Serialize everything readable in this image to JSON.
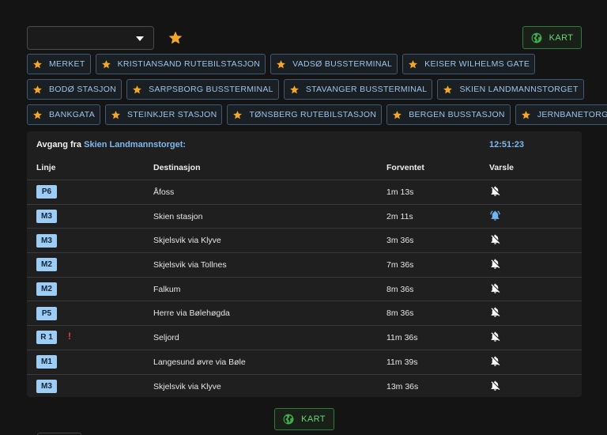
{
  "select": {
    "value": ""
  },
  "map_button": {
    "label": "KART"
  },
  "favorites": [
    [
      "MERKET",
      "KRISTIANSAND RUTEBILSTASJON",
      "VADSØ BUSSTERMINAL",
      "KEISER WILHELMS GATE"
    ],
    [
      "BODØ STASJON",
      "SARPSBORG BUSSTERMINAL",
      "STAVANGER BUSSTERMINAL",
      "SKIEN LANDMANNSTORGET"
    ],
    [
      "BANKGATA",
      "STEINKJER STASJON",
      "TØNSBERG RUTEBILSTASJON",
      "BERGEN BUSSTASJON",
      "JERNBANETORGET"
    ]
  ],
  "departures": {
    "heading_prefix": "Avgang fra",
    "stop_name": "Skien Landmannstorget:",
    "clock": "12:51:23",
    "columns": {
      "line": "Linje",
      "destination": "Destinasjon",
      "expected": "Forventet",
      "notify": "Varsle"
    },
    "rows": [
      {
        "line": "P6",
        "alert": "",
        "destination": "Åfoss",
        "expected": "1m 13s",
        "notify": false
      },
      {
        "line": "M3",
        "alert": "",
        "destination": "Skien stasjon",
        "expected": "2m 11s",
        "notify": true
      },
      {
        "line": "M3",
        "alert": "",
        "destination": "Skjelsvik via Klyve",
        "expected": "3m 36s",
        "notify": false
      },
      {
        "line": "M2",
        "alert": "",
        "destination": "Skjelsvik via Tollnes",
        "expected": "7m 36s",
        "notify": false
      },
      {
        "line": "M2",
        "alert": "",
        "destination": "Falkum",
        "expected": "8m 36s",
        "notify": false
      },
      {
        "line": "P5",
        "alert": "",
        "destination": "Herre via Bølehøgda",
        "expected": "8m 36s",
        "notify": false
      },
      {
        "line": "R 1",
        "alert": "!",
        "destination": "Seljord",
        "expected": "11m 36s",
        "notify": false
      },
      {
        "line": "M1",
        "alert": "",
        "destination": "Langesund øvre via Bøle",
        "expected": "11m 39s",
        "notify": false
      },
      {
        "line": "M3",
        "alert": "",
        "destination": "Skjelsvik via Klyve",
        "expected": "13m 36s",
        "notify": false
      }
    ]
  },
  "icons": {
    "star": "star-icon",
    "globe": "globe-icon",
    "bell_off": "bell-off-icon",
    "bell_ringing": "bell-ringing-icon",
    "dropdown": "chevron-down-icon"
  },
  "colors": {
    "background": "#141414",
    "panel": "#1f1f1f",
    "star": "#f4a62a",
    "favorite_text": "#9fc4ea",
    "line_badge": "#9dccf5",
    "map_green": "#6fd27a",
    "alert_red": "#e0443e",
    "bell_active": "#6fb6f2"
  }
}
